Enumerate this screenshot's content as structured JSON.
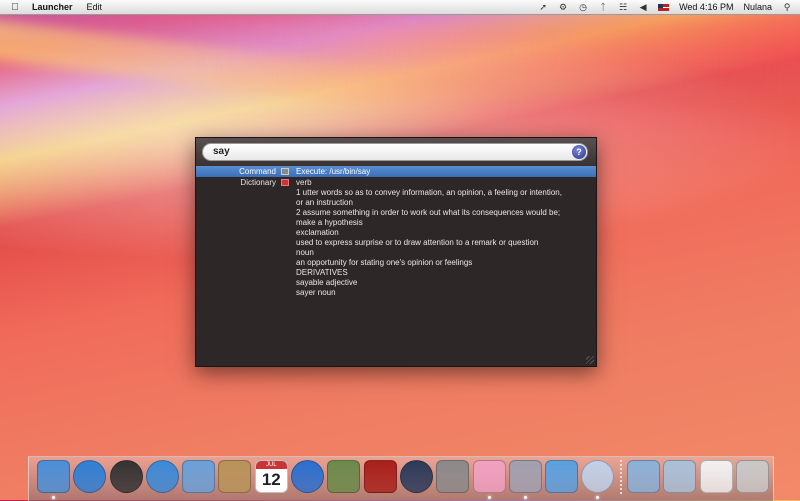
{
  "menubar": {
    "app_name": "Launcher",
    "menus": [
      "Edit"
    ],
    "clock": "Wed 4:16 PM",
    "user": "Nulana",
    "status_icons": [
      "rocket-icon",
      "gear-icon",
      "time-machine-icon",
      "bluetooth-icon",
      "wifi-icon",
      "volume-icon",
      "us-flag-icon",
      "spotlight-icon"
    ]
  },
  "launcher": {
    "query": "say",
    "help_label": "?",
    "results": [
      {
        "category": "Command",
        "icon": "terminal-icon",
        "text": "Execute: /usr/bin/say",
        "selected": true
      },
      {
        "category": "Dictionary",
        "icon": "dictionary-icon",
        "text": "verb",
        "selected": false
      }
    ],
    "definition_lines": [
      "1 utter words so as to convey information, an opinion, a feeling or intention,",
      "or an instruction",
      "2 assume something in order to work out what its consequences would be;",
      "make a hypothesis",
      "exclamation",
      "used to express surprise or to draw attention to a remark or question",
      "noun",
      "an opportunity for stating one's opinion or feelings",
      "DERIVATIVES",
      "sayable adjective",
      "sayer noun"
    ]
  },
  "dock": {
    "apps": [
      {
        "name": "finder-icon",
        "color": "#4a8fd8",
        "running": true
      },
      {
        "name": "app-store-icon",
        "color": "#2f7fd6",
        "running": false
      },
      {
        "name": "dashboard-icon",
        "color": "#333333",
        "running": false
      },
      {
        "name": "safari-icon",
        "color": "#3a8ad8",
        "running": false
      },
      {
        "name": "facetime-icon",
        "color": "#6aa0d8",
        "running": false
      },
      {
        "name": "address-book-icon",
        "color": "#b8935a",
        "running": false
      },
      {
        "name": "ical-icon",
        "color": "#ffffff",
        "running": false
      },
      {
        "name": "itunes-icon",
        "color": "#2a6fd0",
        "running": false
      },
      {
        "name": "iphoto-icon",
        "color": "#6a8a4a",
        "running": false
      },
      {
        "name": "photo-booth-icon",
        "color": "#a8201a",
        "running": false
      },
      {
        "name": "time-machine-icon",
        "color": "#2a3a5a",
        "running": false
      },
      {
        "name": "system-preferences-icon",
        "color": "#8a8a8a",
        "running": false
      },
      {
        "name": "flower-app-icon",
        "color": "#f0a0c0",
        "running": true
      },
      {
        "name": "imovie-icon",
        "color": "#a0a0b0",
        "running": true
      },
      {
        "name": "xcode-icon",
        "color": "#5aa0e0",
        "running": false
      },
      {
        "name": "launcher-rocket-icon",
        "color": "#c0d0e8",
        "running": true
      }
    ],
    "right": [
      {
        "name": "applications-folder-icon",
        "color": "#8ab0d8"
      },
      {
        "name": "documents-folder-icon",
        "color": "#a8c0d8"
      },
      {
        "name": "pdf-document-icon",
        "color": "#f0f0f0"
      },
      {
        "name": "trash-icon",
        "color": "#c8c8c8"
      }
    ],
    "calendar_day": "12",
    "calendar_month": "JUL"
  }
}
